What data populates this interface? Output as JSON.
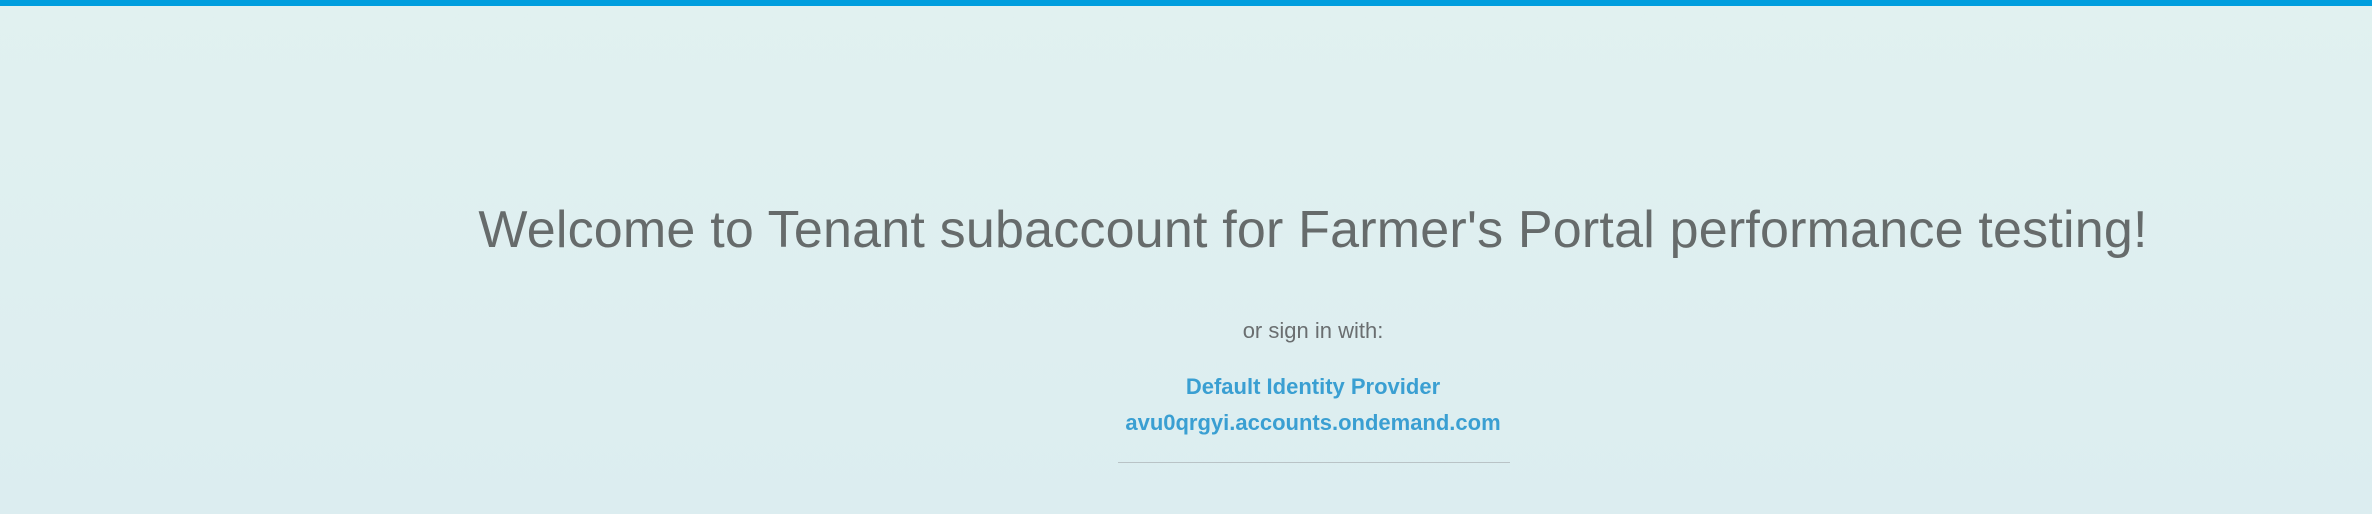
{
  "header": {
    "accent_color": "#009ede"
  },
  "login": {
    "welcome_title": "Welcome to Tenant subaccount for Farmer's Portal performance testing!",
    "sign_in_prompt": "or sign in with:",
    "identity_provider": {
      "name": "Default Identity Provider",
      "host": "avu0qrgyi.accounts.ondemand.com",
      "link_color": "#3a9fd2"
    }
  }
}
